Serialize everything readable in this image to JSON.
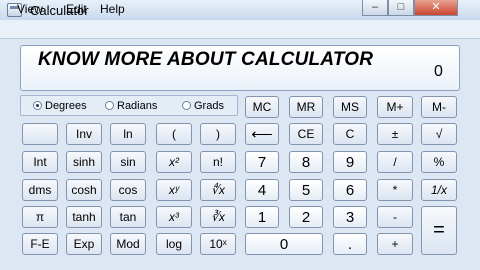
{
  "window": {
    "title": "Calculator",
    "minimize": "–",
    "maximize": "□",
    "close": "✕"
  },
  "menu": [
    "View",
    "Edit",
    "Help"
  ],
  "display": {
    "headline": "KNOW MORE ABOUT CALCULATOR",
    "value": "0"
  },
  "angle_modes": {
    "options": [
      "Degrees",
      "Radians",
      "Grads"
    ],
    "selected": "Degrees"
  },
  "keys": {
    "mc": "MC",
    "mr": "MR",
    "ms": "MS",
    "mplus": "M+",
    "mminus": "M-",
    "inv": "Inv",
    "ln": "ln",
    "lparen": "(",
    "rparen": ")",
    "backspace": "⟵",
    "ce": "CE",
    "clear": "C",
    "plusminus": "±",
    "sqrt": "√",
    "int": "Int",
    "sinh": "sinh",
    "sin": "sin",
    "square": "x²",
    "factorial": "n!",
    "seven": "7",
    "eight": "8",
    "nine": "9",
    "divide": "/",
    "percent": "%",
    "dms": "dms",
    "cosh": "cosh",
    "cos": "cos",
    "power": "xʸ",
    "yroot": "∜x",
    "four": "4",
    "five": "5",
    "six": "6",
    "multiply": "*",
    "reciprocal": "1/x",
    "pi": "π",
    "tanh": "tanh",
    "tan": "tan",
    "cube": "x³",
    "cuberoot": "∛x",
    "one": "1",
    "two": "2",
    "three": "3",
    "minus": "-",
    "equals": "=",
    "fe": "F-E",
    "exp": "Exp",
    "mod": "Mod",
    "log": "log",
    "tenpow": "10ˣ",
    "zero": "0",
    "decimal": ".",
    "plus": "+"
  }
}
